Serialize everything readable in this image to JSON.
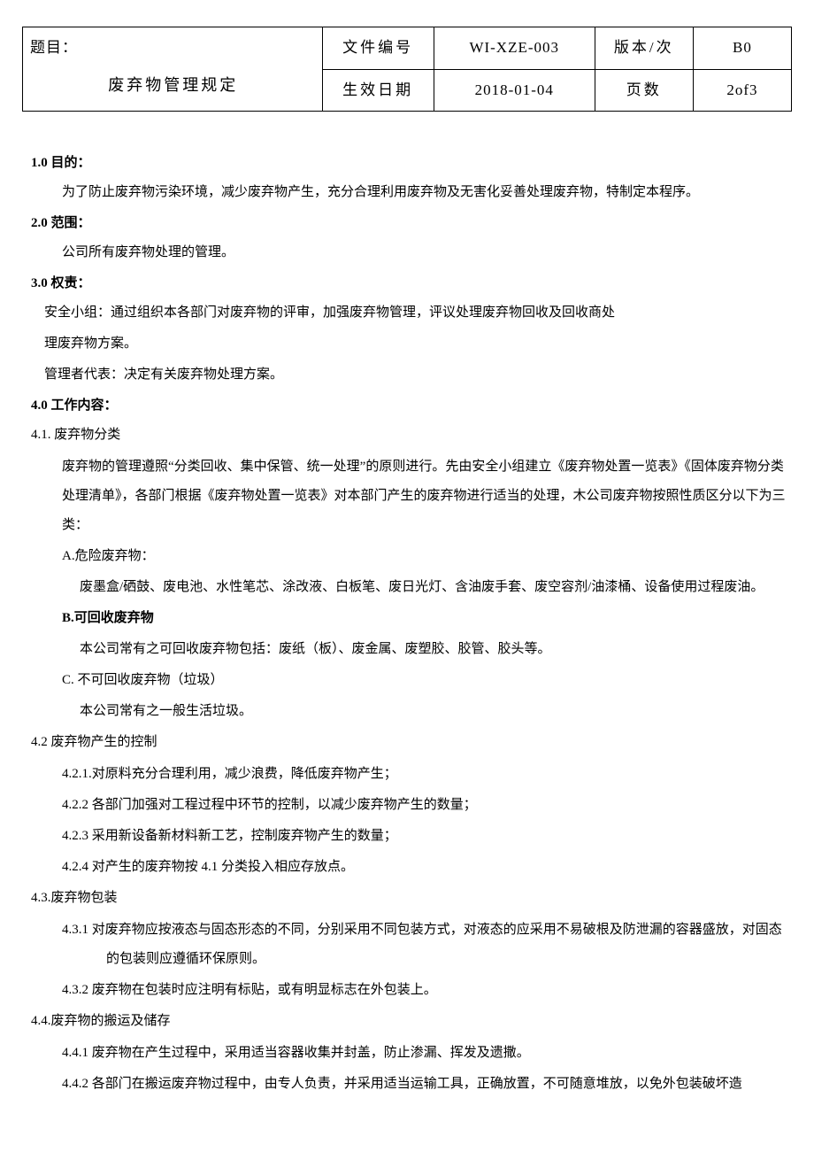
{
  "header": {
    "title_label": "题目：",
    "subtitle": "废弃物管理规定",
    "doc_no_label": "文件编号",
    "doc_no_value": "WI-XZE-003",
    "version_label": "版本/次",
    "version_value": "B0",
    "effective_label": "生效日期",
    "effective_value": "2018-01-04",
    "page_label": "页数",
    "page_value": "2of3"
  },
  "s1": {
    "heading": "1.0 目的：",
    "body": "为了防止废弃物污染环境，减少废弃物产生，充分合理利用废弃物及无害化妥善处理废弃物，特制定本程序。"
  },
  "s2": {
    "heading": "2.0 范围：",
    "body": "公司所有废弃物处理的管理。"
  },
  "s3": {
    "heading": "3.0 权责：",
    "line1": "安全小组：通过组织本各部门对废弃物的评审，加强废弃物管理，评议处理废弃物回收及回收商处",
    "line2": "理废弃物方案。",
    "line3": "管理者代表：决定有关废弃物处理方案。"
  },
  "s4": {
    "heading": "4.0 工作内容："
  },
  "s41": {
    "heading": "4.1. 废弃物分类",
    "body": "废弃物的管理遵照“分类回收、集中保管、统一处理”的原则进行。先由安全小组建立《废弃物处置一览表》《固体废弃物分类处理清单》，各部门根据《废弃物处置一览表》对本部门产生的废弃物进行适当的处理，木公司废弃物按照性质区分以下为三类：",
    "a_label": "A.危险废弃物：",
    "a_body": "废墨盒/硒鼓、废电池、水性笔芯、涂改液、白板笔、废日光灯、含油废手套、废空容剂/油漆桶、设备使用过程废油。",
    "b_label": "B.可回收废弃物",
    "b_body": "本公司常有之可回收废弃物包括：废纸（板）、废金属、废塑胶、胶管、胶头等。",
    "c_label": "C. 不可回收废弃物（垃圾）",
    "c_body": "本公司常有之一般生活垃圾。"
  },
  "s42": {
    "heading": "4.2 废弃物产生的控制",
    "i1": "4.2.1.对原料充分合理利用，减少浪费，降低废弃物产生；",
    "i2": "4.2.2 各部门加强对工程过程中环节的控制，以减少废弃物产生的数量；",
    "i3": "4.2.3 采用新设备新材料新工艺，控制废弃物产生的数量；",
    "i4": "4.2.4 对产生的废弃物按 4.1 分类投入相应存放点。"
  },
  "s43": {
    "heading": "4.3.废弃物包装",
    "i1": "4.3.1 对废弃物应按液态与固态形态的不同，分别采用不同包装方式，对液态的应采用不易破根及防泄漏的容器盛放，对固态的包装则应遵循环保原则。",
    "i2": "4.3.2 废弃物在包装时应注明有标贴，或有明显标志在外包装上。"
  },
  "s44": {
    "heading": "4.4.废弃物的搬运及储存",
    "i1": "4.4.1 废弃物在产生过程中，采用适当容器收集并封盖，防止渗漏、挥发及遗撒。",
    "i2": "4.4.2 各部门在搬运废弃物过程中，由专人负责，并采用适当运输工具，正确放置，不可随意堆放，以免外包装破坏造"
  }
}
